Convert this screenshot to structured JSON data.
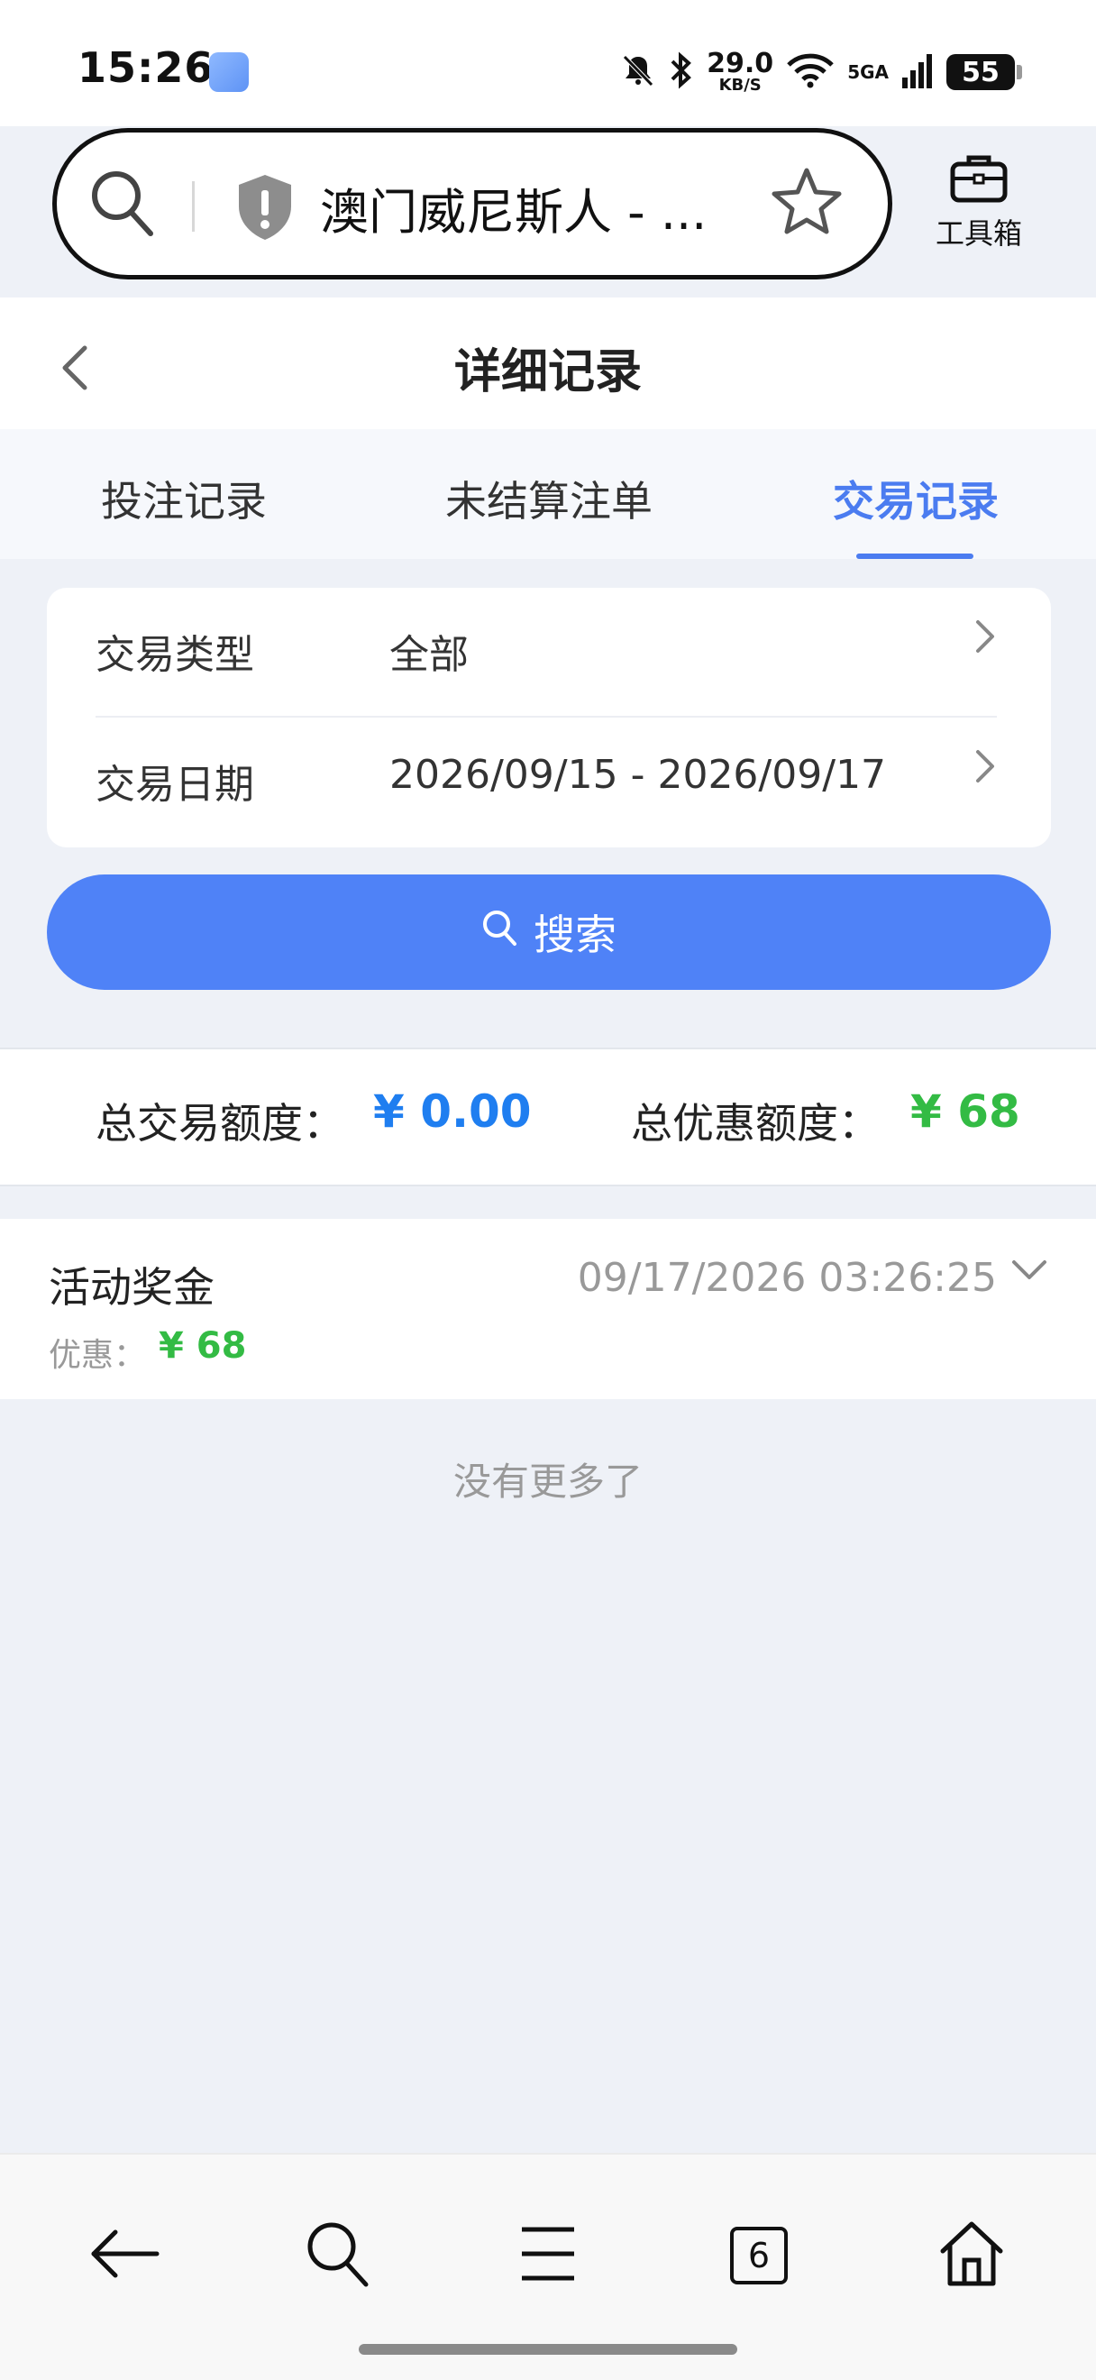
{
  "status_bar": {
    "time": "15:26",
    "speed_value": "29.0",
    "speed_unit": "KB/S",
    "network": "5GA",
    "battery": "55"
  },
  "browser": {
    "url_title": "澳门威尼斯人 - ...",
    "toolbox_label": "工具箱",
    "open_tabs": "6"
  },
  "page": {
    "title": "详细记录"
  },
  "tabs": [
    {
      "label": "投注记录",
      "active": false
    },
    {
      "label": "未结算注单",
      "active": false
    },
    {
      "label": "交易记录",
      "active": true
    }
  ],
  "filters": {
    "type_label": "交易类型",
    "type_value": "全部",
    "date_label": "交易日期",
    "date_value": "2026/09/15 - 2026/09/17"
  },
  "search_button": "搜索",
  "summary": {
    "total_trade_label": "总交易额度：",
    "total_trade_value": "¥ 0.00",
    "total_bonus_label": "总优惠额度：",
    "total_bonus_value": "¥ 68"
  },
  "records": [
    {
      "title": "活动奖金",
      "time": "09/17/2026 03:26:25",
      "sub_label": "优惠：",
      "sub_value": "¥ 68"
    }
  ],
  "no_more_text": "没有更多了",
  "colors": {
    "accent": "#4f82f7",
    "tab_active": "#4b7cf0",
    "amount_blue": "#1f7ef0",
    "amount_green": "#33bb44"
  }
}
